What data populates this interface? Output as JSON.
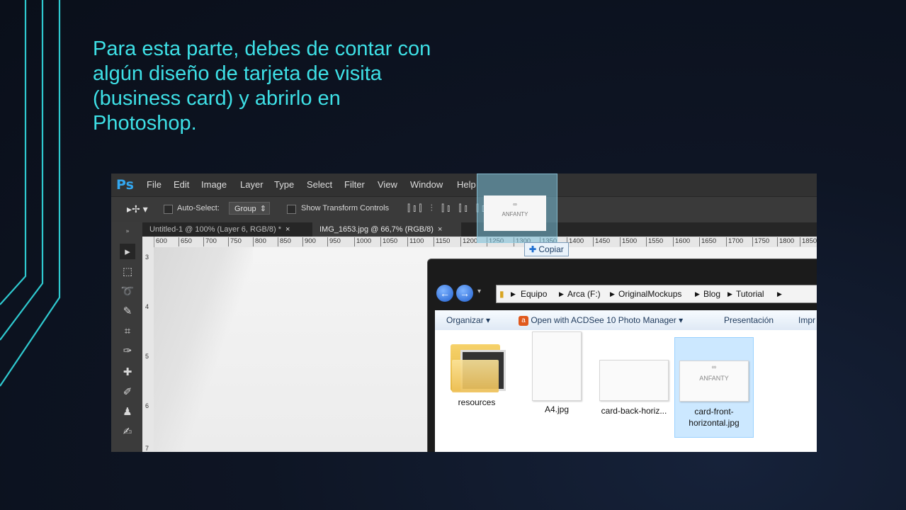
{
  "slide": {
    "text": "Para esta parte, debes de contar con algún diseño de tarjeta de visita (business card) y abrirlo en Photoshop."
  },
  "photoshop": {
    "logo": "Ps",
    "menu": [
      "File",
      "Edit",
      "Image",
      "Layer",
      "Type",
      "Select",
      "Filter",
      "View",
      "Window",
      "Help"
    ],
    "options": {
      "auto_select_label": "Auto-Select:",
      "auto_select_value": "Group",
      "show_transform_label": "Show Transform Controls"
    },
    "tabs": [
      {
        "label": "Untitled-1 @ 100% (Layer 6, RGB/8) *",
        "close": "×"
      },
      {
        "label": "IMG_1653.jpg @ 66,7% (RGB/8)",
        "close": "×"
      }
    ],
    "ruler_ticks": [
      "600",
      "650",
      "700",
      "750",
      "800",
      "850",
      "900",
      "950",
      "1000",
      "1050",
      "1100",
      "1150",
      "1200",
      "1250",
      "1300",
      "1350",
      "1400",
      "1450",
      "1500",
      "1550",
      "1600",
      "1650",
      "1700",
      "1750",
      "1800",
      "1850"
    ],
    "left_ruler": [
      "3",
      "4",
      "5",
      "6",
      "7"
    ],
    "drag_card_logo": "ANFANTY",
    "copy_tooltip": "Copiar"
  },
  "explorer": {
    "breadcrumbs": [
      "Equipo",
      "Arca (F:)",
      "OriginalMockups",
      "Blog",
      "Tutorial"
    ],
    "toolbar": [
      "Organizar",
      "Open with ACDSee 10 Photo Manager",
      "Presentación",
      "Impr"
    ],
    "files": [
      {
        "name": "resources",
        "icon": "folder-icon"
      },
      {
        "name": "A4.jpg",
        "icon": "image-thumbnail"
      },
      {
        "name": "card-back-horiz...",
        "icon": "image-thumbnail"
      },
      {
        "name": "card-front-horizontal.jpg",
        "icon": "image-thumbnail"
      }
    ]
  }
}
